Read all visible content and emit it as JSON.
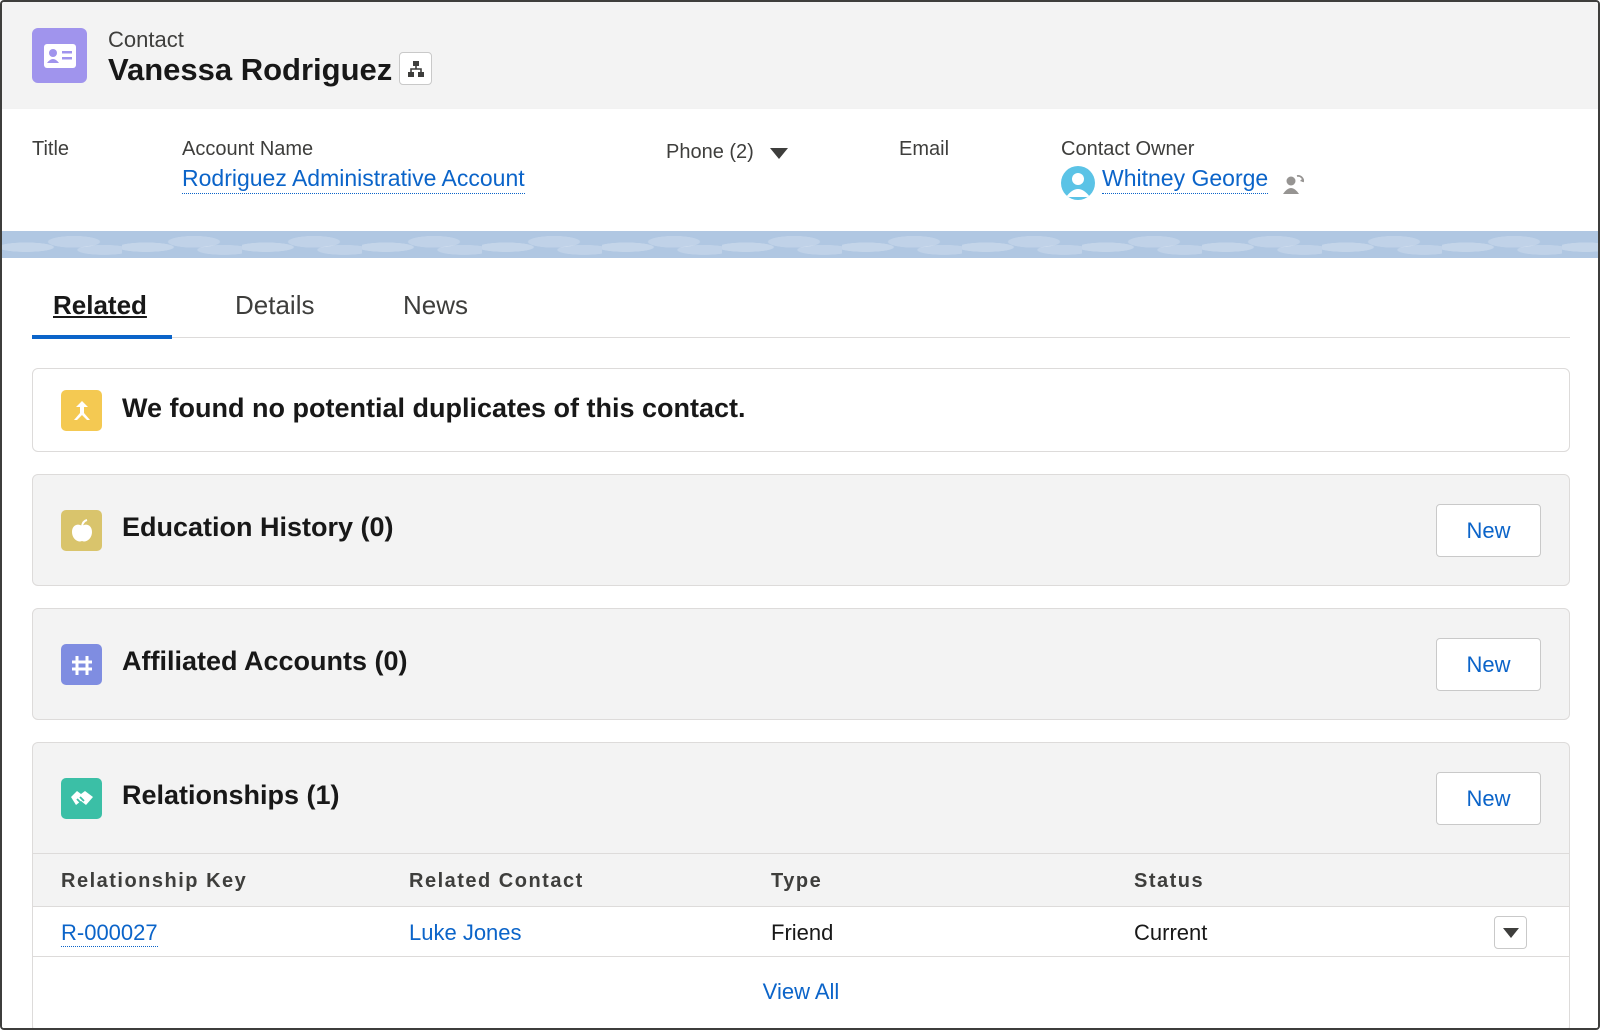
{
  "header": {
    "object_type": "Contact",
    "record_name": "Vanessa Rodriguez",
    "icon": "contact-card-icon",
    "hierarchy_icon": "hierarchy-icon"
  },
  "highlights": {
    "title_label": "Title",
    "account_label": "Account Name",
    "account_value": "Rodriguez Administrative Account",
    "phone_label": "Phone (2)",
    "email_label": "Email",
    "owner_label": "Contact Owner",
    "owner_value": "Whitney George"
  },
  "tabs": [
    {
      "label": "Related",
      "active": true
    },
    {
      "label": "Details",
      "active": false
    },
    {
      "label": "News",
      "active": false
    }
  ],
  "duplicates": {
    "message": "We found no potential duplicates of this contact."
  },
  "related_lists": [
    {
      "title": "Education History (0)",
      "button": "New",
      "icon": "apple-icon",
      "color": "#d9c46c"
    },
    {
      "title": "Affiliated Accounts (0)",
      "button": "New",
      "icon": "affiliation-icon",
      "color": "#7f8de1"
    },
    {
      "title": "Relationships (1)",
      "button": "New",
      "icon": "handshake-icon",
      "color": "#3bbfa6"
    }
  ],
  "relationships_table": {
    "columns": [
      "Relationship Key",
      "Related Contact",
      "Type",
      "Status"
    ],
    "rows": [
      {
        "key": "R-000027",
        "contact": "Luke Jones",
        "type": "Friend",
        "status": "Current"
      }
    ],
    "view_all": "View All"
  },
  "colors": {
    "link": "#0b64c9",
    "contact_icon": "#a094ed",
    "duplicate_icon": "#f4c952"
  }
}
